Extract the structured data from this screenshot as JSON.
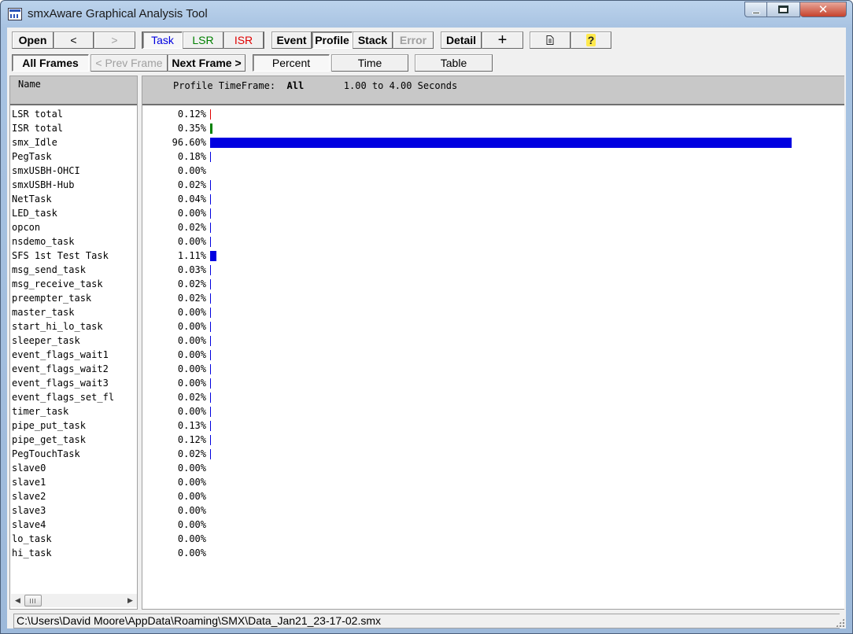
{
  "window": {
    "title": "smxAware Graphical Analysis Tool",
    "close_glyph": "✕"
  },
  "toolbar1": {
    "open": "Open",
    "back": "<",
    "forward": ">",
    "task": "Task",
    "lsr": "LSR",
    "isr": "ISR",
    "event": "Event",
    "profile": "Profile",
    "stack": "Stack",
    "error": "Error",
    "detail": "Detail",
    "add": "+",
    "page_icon": "page-icon",
    "help": "?"
  },
  "toolbar2": {
    "all_frames": "All Frames",
    "prev_frame": "< Prev Frame",
    "next_frame": "Next Frame >",
    "percent": "Percent",
    "time": "Time",
    "table": "Table"
  },
  "colors": {
    "task": "#0000e0",
    "lsr": "#008000",
    "isr": "#e00000",
    "bar_task": "#0000e0",
    "bar_lsr": "#008000",
    "bar_isr": "#e00000"
  },
  "left_header": {
    "name": "Name"
  },
  "profile_header": {
    "label": "Profile TimeFrame:",
    "frame": "All",
    "range": "1.00 to 4.00 Seconds"
  },
  "profile": {
    "rows": [
      {
        "name": "LSR total",
        "pct": "0.12%",
        "value": 0.12,
        "kind": "isr"
      },
      {
        "name": "ISR total",
        "pct": "0.35%",
        "value": 0.35,
        "kind": "lsr"
      },
      {
        "name": "smx_Idle",
        "pct": "96.60%",
        "value": 96.6,
        "kind": "task"
      },
      {
        "name": "PegTask",
        "pct": "0.18%",
        "value": 0.18,
        "kind": "task"
      },
      {
        "name": "smxUSBH-OHCI",
        "pct": "0.00%",
        "value": 0.0,
        "kind": "none"
      },
      {
        "name": "smxUSBH-Hub",
        "pct": "0.02%",
        "value": 0.02,
        "kind": "task"
      },
      {
        "name": "NetTask",
        "pct": "0.04%",
        "value": 0.04,
        "kind": "task"
      },
      {
        "name": "LED_task",
        "pct": "0.00%",
        "value": 0.0,
        "kind": "task"
      },
      {
        "name": "opcon",
        "pct": "0.02%",
        "value": 0.02,
        "kind": "task"
      },
      {
        "name": "nsdemo_task",
        "pct": "0.00%",
        "value": 0.0,
        "kind": "task"
      },
      {
        "name": "SFS 1st Test Task",
        "pct": "1.11%",
        "value": 1.11,
        "kind": "task"
      },
      {
        "name": "msg_send_task",
        "pct": "0.03%",
        "value": 0.03,
        "kind": "task"
      },
      {
        "name": "msg_receive_task",
        "pct": "0.02%",
        "value": 0.02,
        "kind": "task"
      },
      {
        "name": "preempter_task",
        "pct": "0.02%",
        "value": 0.02,
        "kind": "task"
      },
      {
        "name": "master_task",
        "pct": "0.00%",
        "value": 0.0,
        "kind": "task"
      },
      {
        "name": "start_hi_lo_task",
        "pct": "0.00%",
        "value": 0.0,
        "kind": "task"
      },
      {
        "name": "sleeper_task",
        "pct": "0.00%",
        "value": 0.0,
        "kind": "task"
      },
      {
        "name": "event_flags_wait1",
        "pct": "0.00%",
        "value": 0.0,
        "kind": "task"
      },
      {
        "name": "event_flags_wait2",
        "pct": "0.00%",
        "value": 0.0,
        "kind": "task"
      },
      {
        "name": "event_flags_wait3",
        "pct": "0.00%",
        "value": 0.0,
        "kind": "task"
      },
      {
        "name": "event_flags_set_fl",
        "pct": "0.02%",
        "value": 0.02,
        "kind": "task"
      },
      {
        "name": "timer_task",
        "pct": "0.00%",
        "value": 0.0,
        "kind": "task"
      },
      {
        "name": "pipe_put_task",
        "pct": "0.13%",
        "value": 0.13,
        "kind": "task"
      },
      {
        "name": "pipe_get_task",
        "pct": "0.12%",
        "value": 0.12,
        "kind": "task"
      },
      {
        "name": "PegTouchTask",
        "pct": "0.02%",
        "value": 0.02,
        "kind": "task"
      },
      {
        "name": "slave0",
        "pct": "0.00%",
        "value": 0.0,
        "kind": "none"
      },
      {
        "name": "slave1",
        "pct": "0.00%",
        "value": 0.0,
        "kind": "none"
      },
      {
        "name": "slave2",
        "pct": "0.00%",
        "value": 0.0,
        "kind": "none"
      },
      {
        "name": "slave3",
        "pct": "0.00%",
        "value": 0.0,
        "kind": "none"
      },
      {
        "name": "slave4",
        "pct": "0.00%",
        "value": 0.0,
        "kind": "none"
      },
      {
        "name": "lo_task",
        "pct": "0.00%",
        "value": 0.0,
        "kind": "none"
      },
      {
        "name": "hi_task",
        "pct": "0.00%",
        "value": 0.0,
        "kind": "none"
      }
    ]
  },
  "scrollbar": {
    "left": "◀",
    "right": "▶"
  },
  "status": {
    "path": "C:\\Users\\David Moore\\AppData\\Roaming\\SMX\\Data_Jan21_23-17-02.smx"
  }
}
